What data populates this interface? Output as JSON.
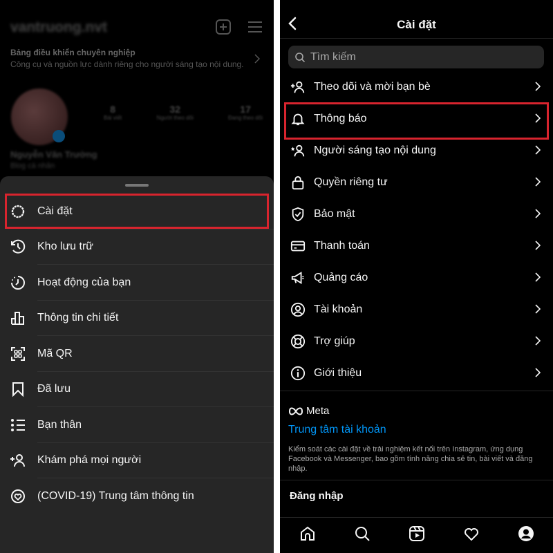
{
  "profile": {
    "username": "vantruong.nvt",
    "pro_dashboard_title": "Bảng điều khiển chuyên nghiệp",
    "pro_dashboard_desc": "Công cụ và nguồn lực dành riêng cho người sáng tạo nội dung.",
    "stats": [
      {
        "value": "8",
        "label": "Bài viết"
      },
      {
        "value": "32",
        "label": "Người theo dõi"
      },
      {
        "value": "17",
        "label": "Đang theo dõi"
      }
    ],
    "name": "Nguyễn Văn Trường",
    "bio": "Blog cá nhân"
  },
  "menu": {
    "items": [
      {
        "label": "Cài đặt",
        "icon": "gear-icon",
        "highlighted": true
      },
      {
        "label": "Kho lưu trữ",
        "icon": "archive-icon"
      },
      {
        "label": "Hoạt động của bạn",
        "icon": "activity-icon"
      },
      {
        "label": "Thông tin chi tiết",
        "icon": "insights-icon"
      },
      {
        "label": "Mã QR",
        "icon": "qr-code-icon"
      },
      {
        "label": "Đã lưu",
        "icon": "bookmark-icon"
      },
      {
        "label": "Bạn thân",
        "icon": "close-friends-icon"
      },
      {
        "label": "Khám phá mọi người",
        "icon": "add-person-icon"
      },
      {
        "label": "(COVID-19) Trung tâm thông tin",
        "icon": "covid-info-icon"
      }
    ]
  },
  "settings": {
    "title": "Cài đặt",
    "search_placeholder": "Tìm kiếm",
    "items": [
      {
        "label": "Theo dõi và mời bạn bè",
        "icon": "add-person-icon"
      },
      {
        "label": "Thông báo",
        "icon": "bell-icon",
        "highlighted": true
      },
      {
        "label": "Người sáng tạo nội dung",
        "icon": "creator-icon"
      },
      {
        "label": "Quyền riêng tư",
        "icon": "lock-icon"
      },
      {
        "label": "Bảo mật",
        "icon": "shield-icon"
      },
      {
        "label": "Thanh toán",
        "icon": "card-icon"
      },
      {
        "label": "Quảng cáo",
        "icon": "megaphone-icon"
      },
      {
        "label": "Tài khoản",
        "icon": "account-icon"
      },
      {
        "label": "Trợ giúp",
        "icon": "help-icon"
      },
      {
        "label": "Giới thiệu",
        "icon": "info-icon"
      }
    ],
    "meta_label": "Meta",
    "accounts_center": "Trung tâm tài khoản",
    "accounts_center_desc": "Kiểm soát các cài đặt về trải nghiệm kết nối trên Instagram, ứng dụng Facebook và Messenger, bao gồm tính năng chia sẻ tin, bài viết và đăng nhập.",
    "login_section": "Đăng nhập"
  },
  "tabbar": [
    {
      "icon": "home-icon"
    },
    {
      "icon": "search-icon"
    },
    {
      "icon": "reels-icon"
    },
    {
      "icon": "heart-icon"
    },
    {
      "icon": "profile-icon"
    }
  ],
  "colors": {
    "highlight": "#d8242e",
    "link": "#0095f6",
    "sheet": "#262626"
  }
}
